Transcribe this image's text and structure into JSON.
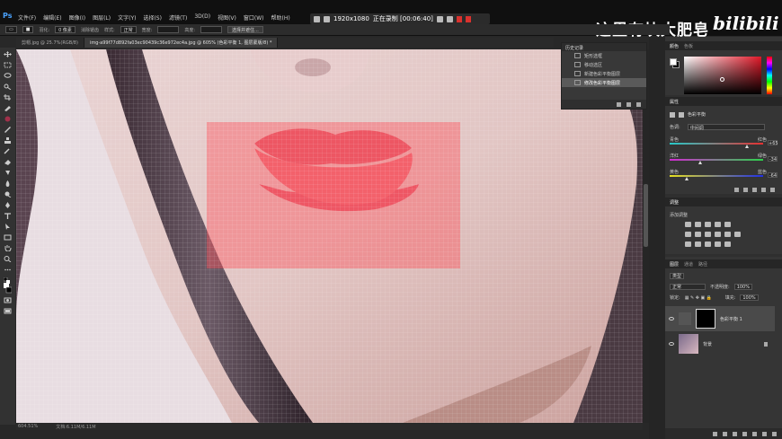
{
  "menubar": {
    "logo": "Ps",
    "items": [
      "文件(F)",
      "编辑(E)",
      "图像(I)",
      "图层(L)",
      "文字(Y)",
      "选择(S)",
      "滤镜(T)",
      "3D(D)",
      "视图(V)",
      "窗口(W)",
      "帮助(H)"
    ]
  },
  "recorder": {
    "resolution": "1920x1080",
    "status": "正在录制 [00:06:40]"
  },
  "watermark": {
    "text": "这里有块大肥皂",
    "logo": "bilibili"
  },
  "options": {
    "feather_label": "羽化:",
    "feather_value": "0 像素",
    "antialias_label": "消除锯齿",
    "style_label": "样式:",
    "style_value": "正常",
    "width_label": "宽度:",
    "height_label": "高度:",
    "select_mask_button": "选择并遮住..."
  },
  "tabs": [
    {
      "label": "剪帽.jpg @ 25.7%(RGB/8)",
      "active": false
    },
    {
      "label": "img-a99f77d892fa03ec90439c36e972ec4a.jpg @ 605% (色彩平衡 1, 图层蒙版/8) *",
      "active": true
    }
  ],
  "history": {
    "title": "历史记录",
    "items": [
      {
        "label": "矩形选框",
        "selected": false
      },
      {
        "label": "移动选区",
        "selected": false
      },
      {
        "label": "新建色彩平衡图层",
        "selected": false
      },
      {
        "label": "修改色彩平衡图层",
        "selected": true
      }
    ]
  },
  "color_panel": {
    "tabs": [
      "颜色",
      "色板"
    ]
  },
  "properties": {
    "tab": "属性",
    "title": "色彩平衡",
    "tone_label": "色调:",
    "tone_value": "中间调",
    "sliders": [
      {
        "left": "青色",
        "right": "红色",
        "value": "+65",
        "fraction": 0.83,
        "track_from": "#26c9c9",
        "track_to": "#e63030"
      },
      {
        "left": "洋红",
        "right": "绿色",
        "value": "-34",
        "fraction": 0.33,
        "track_from": "#d22bd2",
        "track_to": "#2bd24a"
      },
      {
        "left": "黄色",
        "right": "蓝色",
        "value": "-64",
        "fraction": 0.18,
        "track_from": "#e6e020",
        "track_to": "#2030e6"
      }
    ]
  },
  "adjustments": {
    "tab": "调整",
    "subtitle": "添加调整"
  },
  "layers": {
    "tabs": [
      "图层",
      "通道",
      "路径"
    ],
    "kind_label": "类型",
    "blend_mode": "正常",
    "opacity_label": "不透明度:",
    "opacity_value": "100%",
    "lock_label": "锁定:",
    "fill_label": "填充:",
    "fill_value": "100%",
    "items": [
      {
        "name": "色彩平衡 1",
        "active": true
      },
      {
        "name": "背景",
        "active": false
      }
    ]
  },
  "status": {
    "zoom": "604.51%",
    "doc": "文档:6.11M/6.11M"
  }
}
